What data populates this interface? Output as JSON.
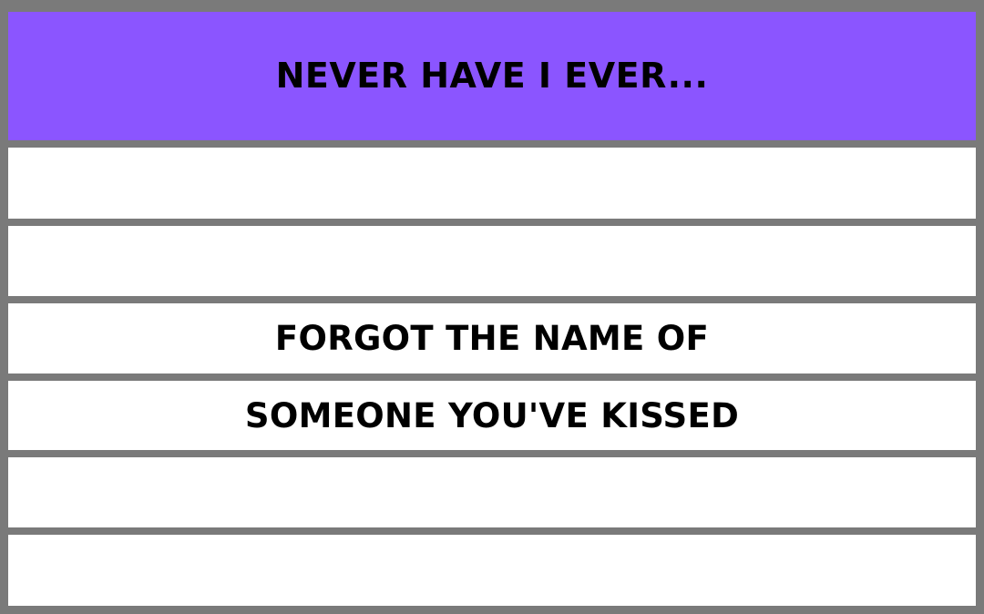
{
  "card": {
    "title": "NEVER HAVE I EVER...",
    "lines": [
      "",
      "",
      "FORGOT THE NAME OF",
      "SOMEONE YOU'VE KISSED",
      "",
      ""
    ]
  },
  "colors": {
    "header_background": "#8b55ff",
    "border": "#7a7a7a",
    "row_background": "#ffffff",
    "text": "#000000"
  }
}
